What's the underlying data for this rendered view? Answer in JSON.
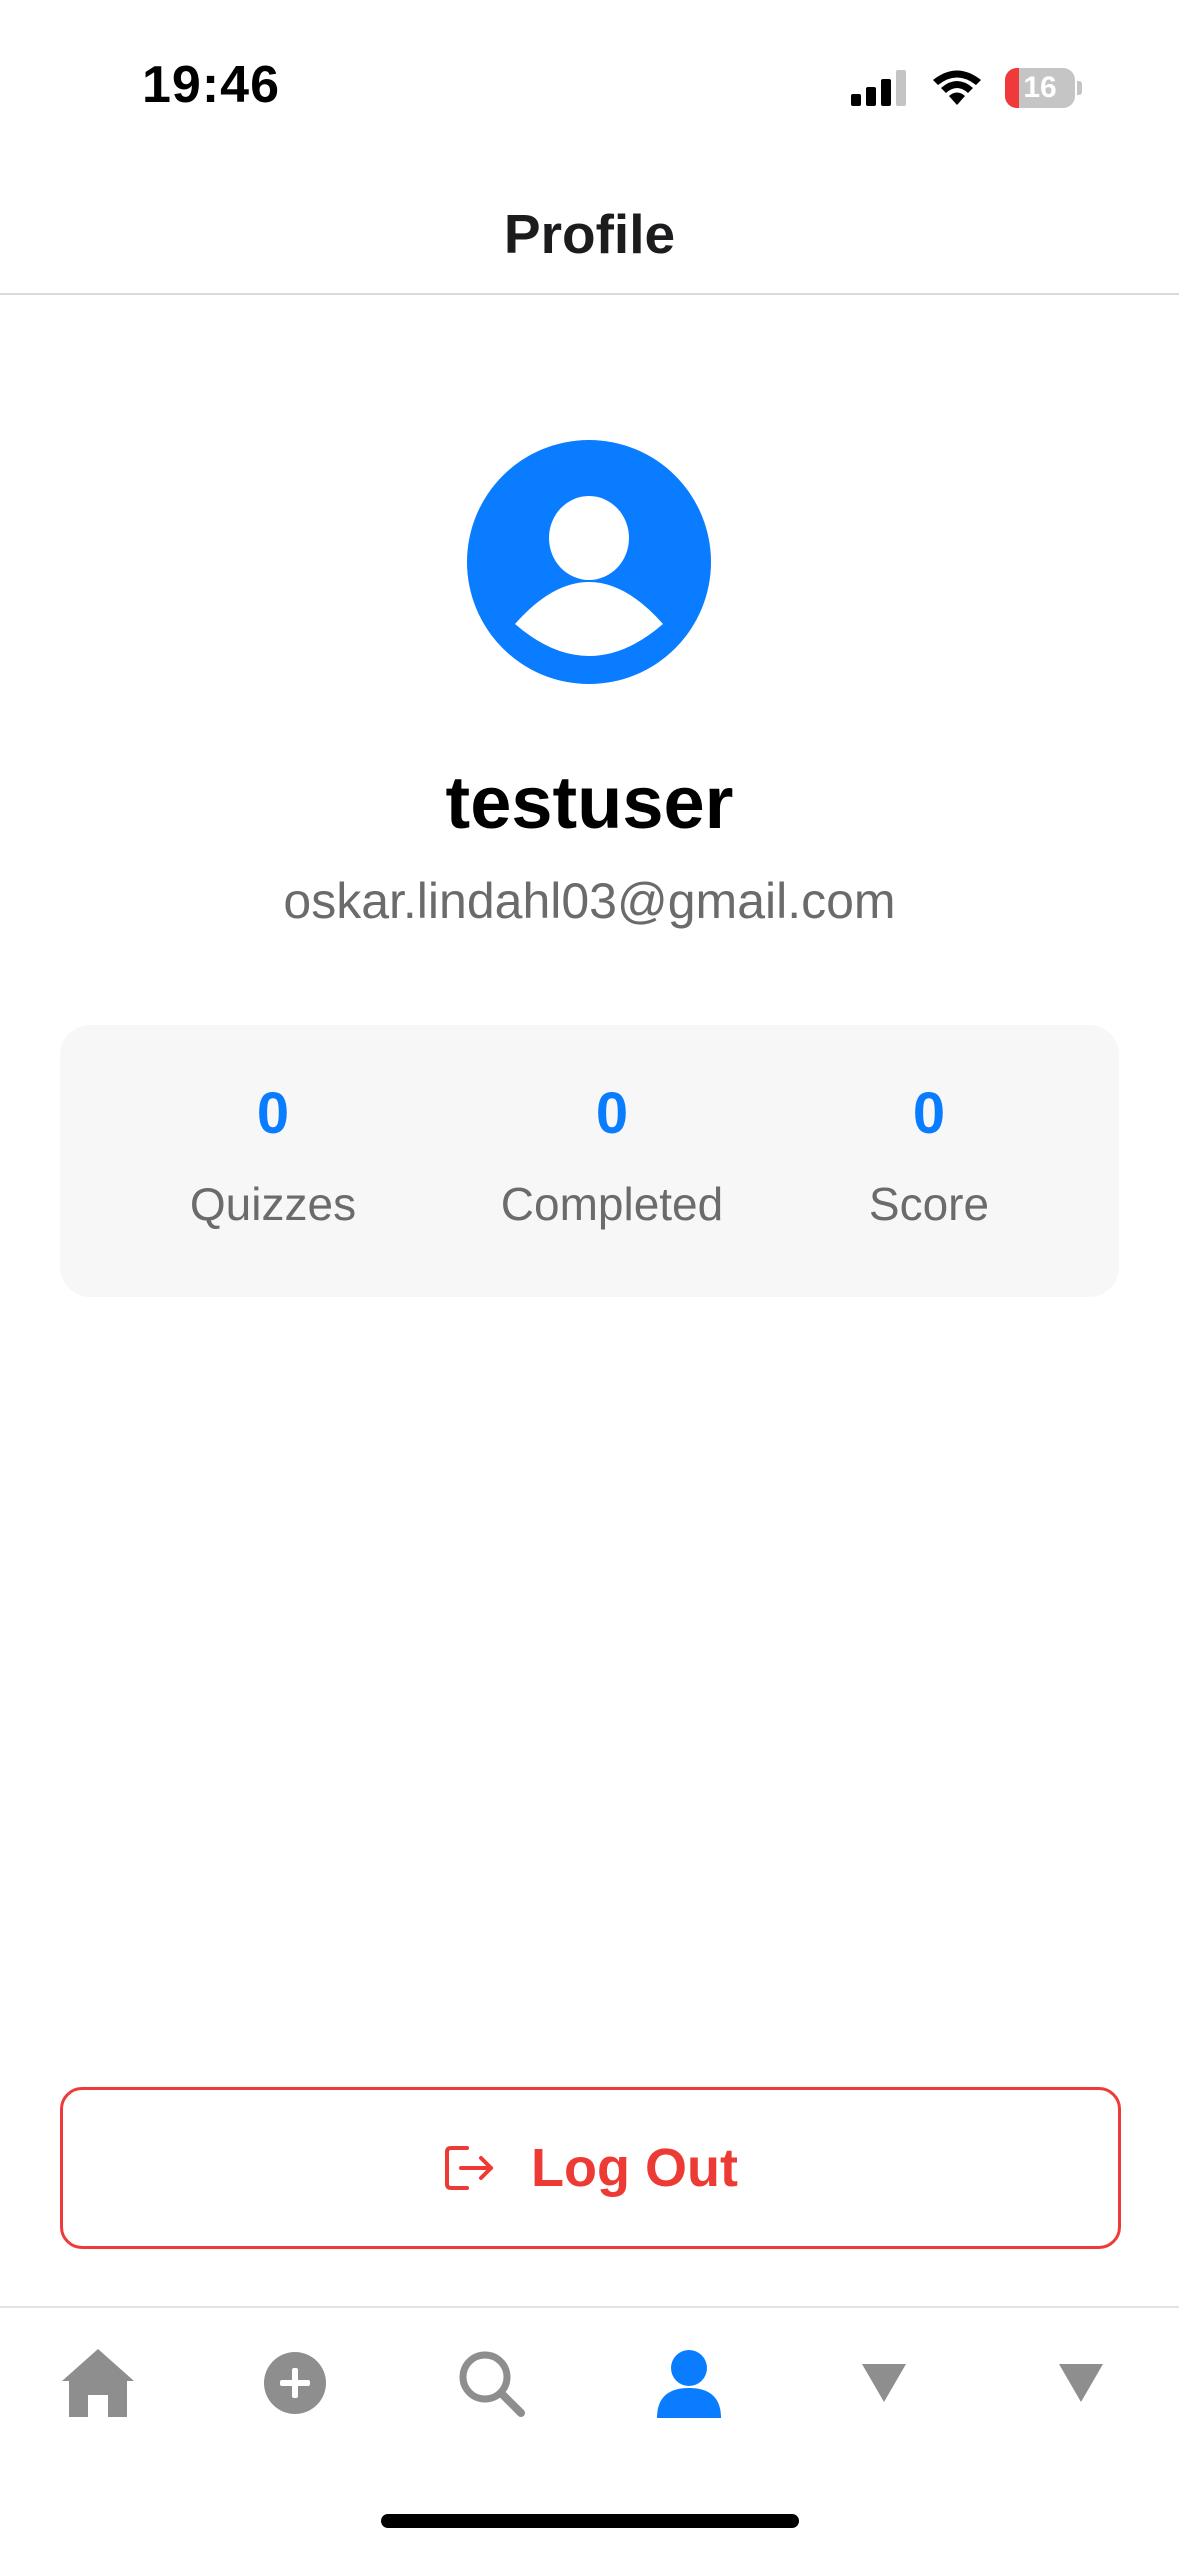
{
  "status_bar": {
    "time": "19:46",
    "battery_level": "16",
    "icons": [
      "cellular-signal-icon",
      "wifi-icon",
      "battery-icon"
    ]
  },
  "nav": {
    "title": "Profile"
  },
  "profile": {
    "avatar_icon": "person-circle-icon",
    "username": "testuser",
    "email": "oskar.lindahl03@gmail.com"
  },
  "stats": [
    {
      "value": "0",
      "label": "Quizzes"
    },
    {
      "value": "0",
      "label": "Completed"
    },
    {
      "value": "0",
      "label": "Score"
    }
  ],
  "logout": {
    "label": "Log Out",
    "icon": "log-out-icon",
    "color": "#ee3a35"
  },
  "tab_bar": {
    "items": [
      {
        "name": "home",
        "icon": "house-icon",
        "active": false
      },
      {
        "name": "create",
        "icon": "plus-circle-icon",
        "active": false
      },
      {
        "name": "search",
        "icon": "search-icon",
        "active": false
      },
      {
        "name": "profile",
        "icon": "person-icon",
        "active": true
      },
      {
        "name": "tab-5",
        "icon": "triangle-down-icon",
        "active": false
      },
      {
        "name": "tab-6",
        "icon": "triangle-down-icon",
        "active": false
      }
    ]
  },
  "colors": {
    "accent": "#0a7cff",
    "danger": "#ee3a35",
    "inactive": "#8e8e8e"
  }
}
